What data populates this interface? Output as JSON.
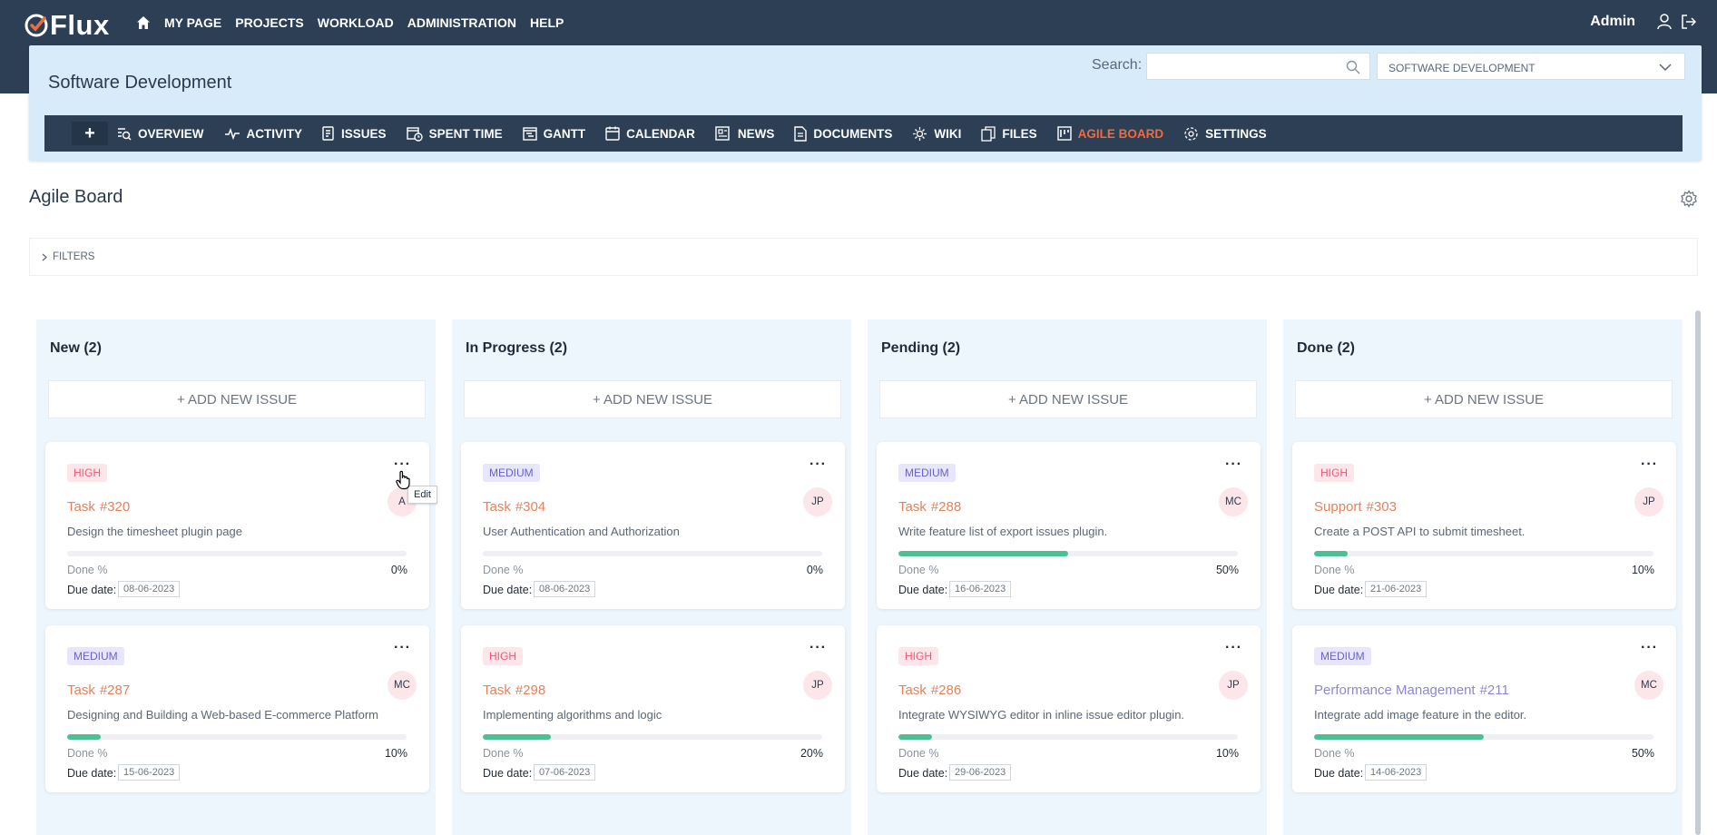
{
  "app": {
    "logo_text": "Flux",
    "user": "Admin"
  },
  "main_nav": [
    "MY PAGE",
    "PROJECTS",
    "WORKLOAD",
    "ADMINISTRATION",
    "HELP"
  ],
  "project": {
    "title": "Software Development",
    "search_label": "Search:",
    "search_placeholder": "",
    "selector_value": "SOFTWARE DEVELOPMENT"
  },
  "tabs": [
    {
      "label": "OVERVIEW",
      "icon": "overview-icon",
      "active": false
    },
    {
      "label": "ACTIVITY",
      "icon": "activity-icon",
      "active": false
    },
    {
      "label": "ISSUES",
      "icon": "issues-icon",
      "active": false
    },
    {
      "label": "SPENT TIME",
      "icon": "spent-time-icon",
      "active": false
    },
    {
      "label": "GANTT",
      "icon": "gantt-icon",
      "active": false
    },
    {
      "label": "CALENDAR",
      "icon": "calendar-icon",
      "active": false
    },
    {
      "label": "NEWS",
      "icon": "news-icon",
      "active": false
    },
    {
      "label": "DOCUMENTS",
      "icon": "documents-icon",
      "active": false
    },
    {
      "label": "WIKI",
      "icon": "wiki-icon",
      "active": false
    },
    {
      "label": "FILES",
      "icon": "files-icon",
      "active": false
    },
    {
      "label": "AGILE BOARD",
      "icon": "agile-board-icon",
      "active": true
    },
    {
      "label": "SETTINGS",
      "icon": "settings-icon",
      "active": false
    }
  ],
  "page": {
    "title": "Agile Board",
    "filters_label": "FILTERS"
  },
  "tooltip": "Edit",
  "board": {
    "add_label": "+ ADD NEW ISSUE",
    "done_label": "Done %",
    "due_label": "Due date:",
    "columns": [
      {
        "title": "New (2)",
        "cards": [
          {
            "priority": "HIGH",
            "tracker": "Task",
            "number": "#320",
            "assignee": "A",
            "description": "Design the timesheet plugin page",
            "done": "0%",
            "done_fraction": 0,
            "due": "08-06-2023"
          },
          {
            "priority": "MEDIUM",
            "tracker": "Task",
            "number": "#287",
            "assignee": "MC",
            "description": "Designing and Building a Web-based E-commerce Platform",
            "done": "10%",
            "done_fraction": 0.1,
            "due": "15-06-2023"
          }
        ]
      },
      {
        "title": "In Progress (2)",
        "cards": [
          {
            "priority": "MEDIUM",
            "tracker": "Task",
            "number": "#304",
            "assignee": "JP",
            "description": "User Authentication and Authorization",
            "done": "0%",
            "done_fraction": 0,
            "due": "08-06-2023"
          },
          {
            "priority": "HIGH",
            "tracker": "Task",
            "number": "#298",
            "assignee": "JP",
            "description": "Implementing algorithms and logic",
            "done": "20%",
            "done_fraction": 0.2,
            "due": "07-06-2023"
          }
        ]
      },
      {
        "title": "Pending (2)",
        "cards": [
          {
            "priority": "MEDIUM",
            "tracker": "Task",
            "number": "#288",
            "assignee": "MC",
            "description": "Write feature list of export issues plugin.",
            "done": "50%",
            "done_fraction": 0.5,
            "due": "16-06-2023"
          },
          {
            "priority": "HIGH",
            "tracker": "Task",
            "number": "#286",
            "assignee": "JP",
            "description": "Integrate WYSIWYG editor in inline issue editor plugin.",
            "done": "10%",
            "done_fraction": 0.1,
            "due": "29-06-2023"
          }
        ]
      },
      {
        "title": "Done (2)",
        "cards": [
          {
            "priority": "HIGH",
            "tracker": "Support",
            "number": "#303",
            "assignee": "JP",
            "description": "Create a POST API to submit timesheet.",
            "done": "10%",
            "done_fraction": 0.1,
            "due": "21-06-2023"
          },
          {
            "priority": "MEDIUM",
            "tracker": "Performance Management",
            "number": "#211",
            "assignee": "MC",
            "description": "Integrate add image feature in the editor.",
            "done": "50%",
            "done_fraction": 0.5,
            "due": "14-06-2023"
          }
        ]
      }
    ]
  },
  "colors": {
    "topbar": "#2d3f55",
    "accent": "#ef6b3d",
    "progress": "#4cbf95",
    "link": "#e4825b"
  }
}
